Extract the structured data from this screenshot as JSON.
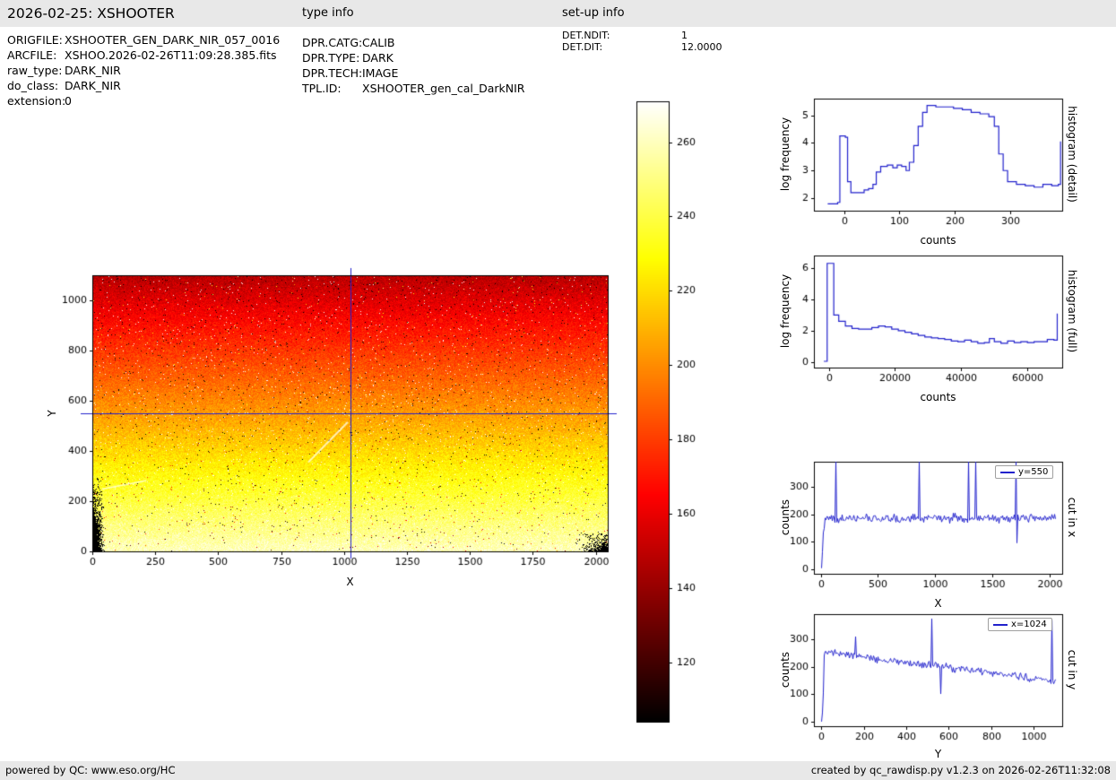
{
  "header": {
    "title": "2026-02-25: XSHOOTER",
    "type_info_label": "type info",
    "setup_info_label": "set-up info"
  },
  "file_info": {
    "rows": [
      {
        "label": "ORIGFILE:",
        "value": "XSHOOTER_GEN_DARK_NIR_057_0016"
      },
      {
        "label": "ARCFILE:",
        "value": "XSHOO.2026-02-26T11:09:28.385.fits"
      },
      {
        "label": "raw_type:",
        "value": "DARK_NIR"
      },
      {
        "label": "do_class:",
        "value": "DARK_NIR"
      },
      {
        "label": "extension:",
        "value": "0"
      }
    ]
  },
  "type_info": {
    "rows": [
      {
        "label": "DPR.CATG:",
        "value": "CALIB"
      },
      {
        "label": "DPR.TYPE:",
        "value": "DARK"
      },
      {
        "label": "DPR.TECH:",
        "value": "IMAGE"
      },
      {
        "label": "TPL.ID:",
        "value": "XSHOOTER_gen_cal_DarkNIR"
      }
    ]
  },
  "setup_info": {
    "rows": [
      {
        "label": "DET.NDIT:",
        "value": "1"
      },
      {
        "label": "DET.DIT:",
        "value": "12.0000"
      }
    ]
  },
  "footer": {
    "left": "powered by QC: www.eso.org/HC",
    "right": "created by qc_rawdisp.py v1.2.3 on 2026-02-26T11:32:08"
  },
  "chart_data": [
    {
      "id": "detector-image",
      "type": "heatmap",
      "xlabel": "X",
      "ylabel": "Y",
      "xlim": [
        0,
        2048
      ],
      "ylim": [
        0,
        1100
      ],
      "xticks": [
        0,
        250,
        500,
        750,
        1000,
        1250,
        1500,
        1750,
        2000
      ],
      "yticks": [
        0,
        200,
        400,
        600,
        800,
        1000
      ],
      "colormap": "hot",
      "value_range": [
        104,
        271
      ],
      "gradient_counts_bottom_to_top": [
        260,
        148
      ],
      "noise_sigma": 5,
      "hot_pixel_fraction": 0.012,
      "dark_pixel_fraction": 0.011,
      "bad_pixel_corners": [
        "bottom-left",
        "bottom-right"
      ],
      "crosshair": {
        "x": 1024,
        "y": 550,
        "color": "#2222cc"
      }
    },
    {
      "id": "colorbar",
      "type": "colorbar",
      "colormap": "hot",
      "range": [
        104,
        271
      ],
      "ticks": [
        120,
        140,
        160,
        180,
        200,
        220,
        240,
        260
      ]
    },
    {
      "id": "histogram-detail",
      "type": "line",
      "step": true,
      "xlabel": "counts",
      "ylabel": "log frequency",
      "right_label": "histogram (detail)",
      "xlim": [
        -55,
        395
      ],
      "ylim": [
        1.55,
        5.6
      ],
      "xticks": [
        0,
        100,
        200,
        300
      ],
      "yticks": [
        2,
        3,
        4,
        5
      ],
      "color": "#2222cc",
      "points": [
        [
          -30,
          1.8
        ],
        [
          -12,
          1.85
        ],
        [
          -8,
          4.25
        ],
        [
          2,
          4.2
        ],
        [
          6,
          2.6
        ],
        [
          12,
          2.2
        ],
        [
          28,
          2.2
        ],
        [
          36,
          2.3
        ],
        [
          44,
          2.35
        ],
        [
          52,
          2.5
        ],
        [
          58,
          2.95
        ],
        [
          66,
          3.15
        ],
        [
          78,
          3.2
        ],
        [
          88,
          3.1
        ],
        [
          96,
          3.2
        ],
        [
          104,
          3.15
        ],
        [
          112,
          3.0
        ],
        [
          118,
          3.3
        ],
        [
          126,
          3.9
        ],
        [
          134,
          4.6
        ],
        [
          142,
          5.1
        ],
        [
          150,
          5.35
        ],
        [
          166,
          5.3
        ],
        [
          182,
          5.3
        ],
        [
          198,
          5.25
        ],
        [
          214,
          5.2
        ],
        [
          230,
          5.1
        ],
        [
          246,
          5.05
        ],
        [
          262,
          4.95
        ],
        [
          272,
          4.6
        ],
        [
          280,
          3.6
        ],
        [
          288,
          3.0
        ],
        [
          296,
          2.6
        ],
        [
          312,
          2.5
        ],
        [
          328,
          2.45
        ],
        [
          344,
          2.4
        ],
        [
          360,
          2.5
        ],
        [
          376,
          2.45
        ],
        [
          388,
          2.5
        ],
        [
          392,
          4.05
        ]
      ]
    },
    {
      "id": "histogram-full",
      "type": "line",
      "step": true,
      "xlabel": "counts",
      "ylabel": "log frequency",
      "right_label": "histogram (full)",
      "xlim": [
        -4500,
        70500
      ],
      "ylim": [
        -0.35,
        6.8
      ],
      "xticks": [
        0,
        20000,
        40000,
        60000
      ],
      "yticks": [
        0,
        2,
        4,
        6
      ],
      "color": "#2222cc",
      "points": [
        [
          -1500,
          0.05
        ],
        [
          -500,
          6.3
        ],
        [
          1500,
          3.0
        ],
        [
          3000,
          2.6
        ],
        [
          5000,
          2.3
        ],
        [
          7000,
          2.15
        ],
        [
          9000,
          2.1
        ],
        [
          11000,
          2.1
        ],
        [
          13000,
          2.2
        ],
        [
          15000,
          2.3
        ],
        [
          17000,
          2.25
        ],
        [
          19000,
          2.1
        ],
        [
          21000,
          2.0
        ],
        [
          23000,
          1.9
        ],
        [
          25000,
          1.8
        ],
        [
          27000,
          1.7
        ],
        [
          29000,
          1.6
        ],
        [
          31000,
          1.55
        ],
        [
          33000,
          1.5
        ],
        [
          35000,
          1.45
        ],
        [
          37000,
          1.35
        ],
        [
          39000,
          1.3
        ],
        [
          41000,
          1.4
        ],
        [
          43000,
          1.3
        ],
        [
          45000,
          1.2
        ],
        [
          47000,
          1.25
        ],
        [
          48500,
          1.5
        ],
        [
          50000,
          1.3
        ],
        [
          52000,
          1.2
        ],
        [
          54000,
          1.35
        ],
        [
          56000,
          1.25
        ],
        [
          58000,
          1.3
        ],
        [
          60000,
          1.25
        ],
        [
          62000,
          1.3
        ],
        [
          64000,
          1.3
        ],
        [
          66000,
          1.45
        ],
        [
          68000,
          1.4
        ],
        [
          69000,
          3.1
        ]
      ]
    },
    {
      "id": "cut-in-x",
      "type": "line",
      "noisy": true,
      "xlabel": "X",
      "ylabel": "counts",
      "right_label": "cut in x",
      "legend": "y=550",
      "xlim": [
        -60,
        2110
      ],
      "ylim": [
        -18,
        392
      ],
      "xticks": [
        0,
        500,
        1000,
        1500,
        2000
      ],
      "yticks": [
        0,
        100,
        200,
        300
      ],
      "color": "#2222cc",
      "data_range": [
        0,
        2048
      ],
      "baseline": [
        [
          0,
          2
        ],
        [
          14,
          90
        ],
        [
          30,
          183
        ],
        [
          2048,
          187
        ]
      ],
      "noise_sigma": 8,
      "spikes": [
        {
          "x": 130,
          "y": 392
        },
        {
          "x": 858,
          "y": 392
        },
        {
          "x": 1285,
          "y": 392
        },
        {
          "x": 1350,
          "y": 392
        },
        {
          "x": 1700,
          "y": 392
        },
        {
          "x": 1712,
          "y": 95
        }
      ]
    },
    {
      "id": "cut-in-y",
      "type": "line",
      "noisy": true,
      "xlabel": "Y",
      "ylabel": "counts",
      "right_label": "cut in y",
      "legend": "x=1024",
      "xlim": [
        -35,
        1135
      ],
      "ylim": [
        -18,
        392
      ],
      "xticks": [
        0,
        200,
        400,
        600,
        800,
        1000
      ],
      "yticks": [
        0,
        100,
        200,
        300
      ],
      "color": "#2222cc",
      "data_range": [
        0,
        1100
      ],
      "baseline": [
        [
          0,
          2
        ],
        [
          6,
          60
        ],
        [
          12,
          258
        ],
        [
          300,
          222
        ],
        [
          600,
          198
        ],
        [
          900,
          168
        ],
        [
          1100,
          148
        ]
      ],
      "noise_sigma": 7,
      "spikes": [
        {
          "x": 160,
          "y": 310
        },
        {
          "x": 520,
          "y": 375
        },
        {
          "x": 560,
          "y": 100
        },
        {
          "x": 1085,
          "y": 370
        }
      ]
    }
  ]
}
